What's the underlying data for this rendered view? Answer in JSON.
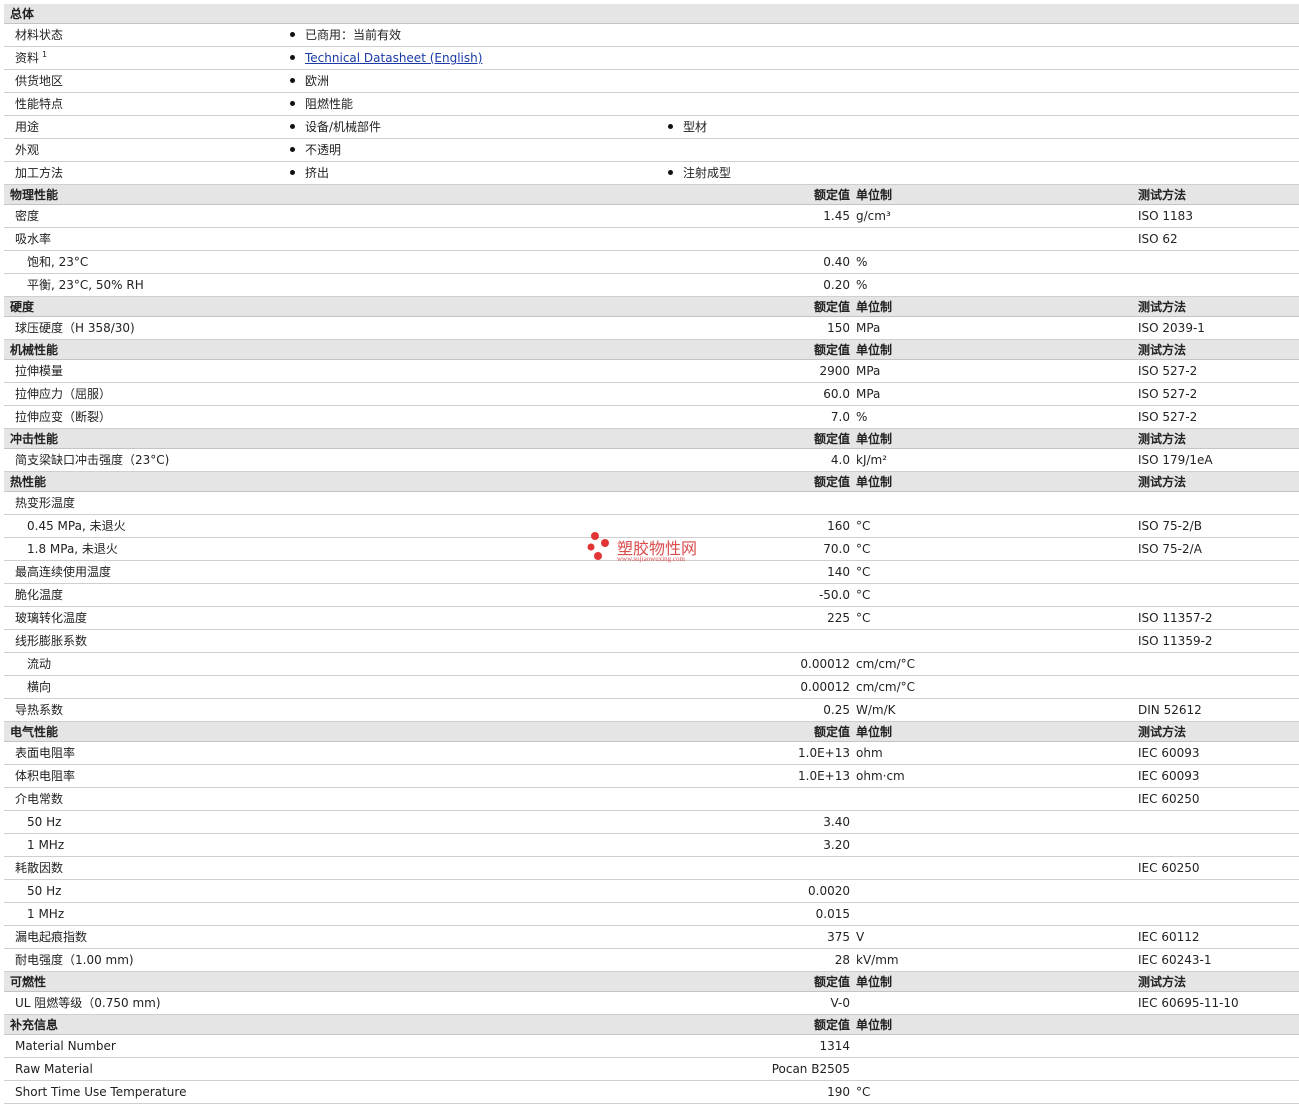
{
  "general": {
    "title": "总体",
    "rows": [
      {
        "label": "材料状态",
        "items": [
          "已商用：当前有效"
        ]
      },
      {
        "label": "资料",
        "sup": "1",
        "items": [
          "Technical Datasheet (English)"
        ],
        "link": true
      },
      {
        "label": "供货地区",
        "items": [
          "欧洲"
        ]
      },
      {
        "label": "性能特点",
        "items": [
          "阻燃性能"
        ]
      },
      {
        "label": "用途",
        "items": [
          "设备/机械部件",
          "型材"
        ]
      },
      {
        "label": "外观",
        "items": [
          "不透明"
        ]
      },
      {
        "label": "加工方法",
        "items": [
          "挤出",
          "注射成型"
        ]
      }
    ]
  },
  "column_headers": {
    "value": "额定值",
    "unit": "单位制",
    "test": "测试方法"
  },
  "sections": [
    {
      "title": "物理性能",
      "rows": [
        {
          "label": "密度",
          "value": "1.45",
          "unit": "g/cm³",
          "test": "ISO 1183"
        },
        {
          "label": "吸水率",
          "value": "",
          "unit": "",
          "test": "ISO 62"
        },
        {
          "label": "饱和, 23°C",
          "sub": true,
          "value": "0.40",
          "unit": "%",
          "test": ""
        },
        {
          "label": "平衡, 23°C, 50% RH",
          "sub": true,
          "value": "0.20",
          "unit": "%",
          "test": ""
        }
      ]
    },
    {
      "title": "硬度",
      "rows": [
        {
          "label": "球压硬度（H 358/30)",
          "value": "150",
          "unit": "MPa",
          "test": "ISO 2039-1"
        }
      ]
    },
    {
      "title": "机械性能",
      "rows": [
        {
          "label": "拉伸模量",
          "value": "2900",
          "unit": "MPa",
          "test": "ISO 527-2"
        },
        {
          "label": "拉伸应力（屈服）",
          "value": "60.0",
          "unit": "MPa",
          "test": "ISO 527-2"
        },
        {
          "label": "拉伸应变（断裂）",
          "value": "7.0",
          "unit": "%",
          "test": "ISO 527-2"
        }
      ]
    },
    {
      "title": "冲击性能",
      "rows": [
        {
          "label": "简支梁缺口冲击强度（23°C)",
          "value": "4.0",
          "unit": "kJ/m²",
          "test": "ISO 179/1eA"
        }
      ]
    },
    {
      "title": "热性能",
      "rows": [
        {
          "label": "热变形温度",
          "value": "",
          "unit": "",
          "test": ""
        },
        {
          "label": "0.45 MPa, 未退火",
          "sub": true,
          "value": "160",
          "unit": "°C",
          "test": "ISO 75-2/B"
        },
        {
          "label": "1.8 MPa, 未退火",
          "sub": true,
          "value": "70.0",
          "unit": "°C",
          "test": "ISO 75-2/A"
        },
        {
          "label": "最高连续使用温度",
          "value": "140",
          "unit": "°C",
          "test": ""
        },
        {
          "label": "脆化温度",
          "value": "-50.0",
          "unit": "°C",
          "test": ""
        },
        {
          "label": "玻璃转化温度",
          "value": "225",
          "unit": "°C",
          "test": "ISO 11357-2"
        },
        {
          "label": "线形膨胀系数",
          "value": "",
          "unit": "",
          "test": "ISO 11359-2"
        },
        {
          "label": "流动",
          "sub": true,
          "value": "0.00012",
          "unit": "cm/cm/°C",
          "test": ""
        },
        {
          "label": "横向",
          "sub": true,
          "value": "0.00012",
          "unit": "cm/cm/°C",
          "test": ""
        },
        {
          "label": "导热系数",
          "value": "0.25",
          "unit": "W/m/K",
          "test": "DIN 52612"
        }
      ]
    },
    {
      "title": "电气性能",
      "rows": [
        {
          "label": "表面电阻率",
          "value": "1.0E+13",
          "unit": "ohm",
          "test": "IEC 60093"
        },
        {
          "label": "体积电阻率",
          "value": "1.0E+13",
          "unit": "ohm·cm",
          "test": "IEC 60093"
        },
        {
          "label": "介电常数",
          "value": "",
          "unit": "",
          "test": "IEC 60250"
        },
        {
          "label": "50 Hz",
          "sub": true,
          "value": "3.40",
          "unit": "",
          "test": ""
        },
        {
          "label": "1 MHz",
          "sub": true,
          "value": "3.20",
          "unit": "",
          "test": ""
        },
        {
          "label": "耗散因数",
          "value": "",
          "unit": "",
          "test": "IEC 60250"
        },
        {
          "label": "50 Hz",
          "sub": true,
          "value": "0.0020",
          "unit": "",
          "test": ""
        },
        {
          "label": "1 MHz",
          "sub": true,
          "value": "0.015",
          "unit": "",
          "test": ""
        },
        {
          "label": "漏电起痕指数",
          "value": "375",
          "unit": "V",
          "test": "IEC 60112"
        },
        {
          "label": "耐电强度（1.00 mm)",
          "value": "28",
          "unit": "kV/mm",
          "test": "IEC 60243-1"
        }
      ]
    },
    {
      "title": "可燃性",
      "rows": [
        {
          "label": "UL 阻燃等级（0.750 mm)",
          "value": "V-0",
          "unit": "",
          "test": "IEC 60695-11-10"
        }
      ]
    },
    {
      "title": "补充信息",
      "noTest": true,
      "rows": [
        {
          "label": "Material Number",
          "value": "1314",
          "unit": "",
          "test": ""
        },
        {
          "label": "Raw Material",
          "value": "Pocan B2505",
          "unit": "",
          "test": ""
        },
        {
          "label": "Short Time Use Temperature",
          "value": "190",
          "unit": "°C",
          "test": ""
        }
      ]
    }
  ],
  "watermark": {
    "text": "塑胶物性网",
    "url": "www.sujiaowuxing.com",
    "color": "#d63a3a"
  }
}
